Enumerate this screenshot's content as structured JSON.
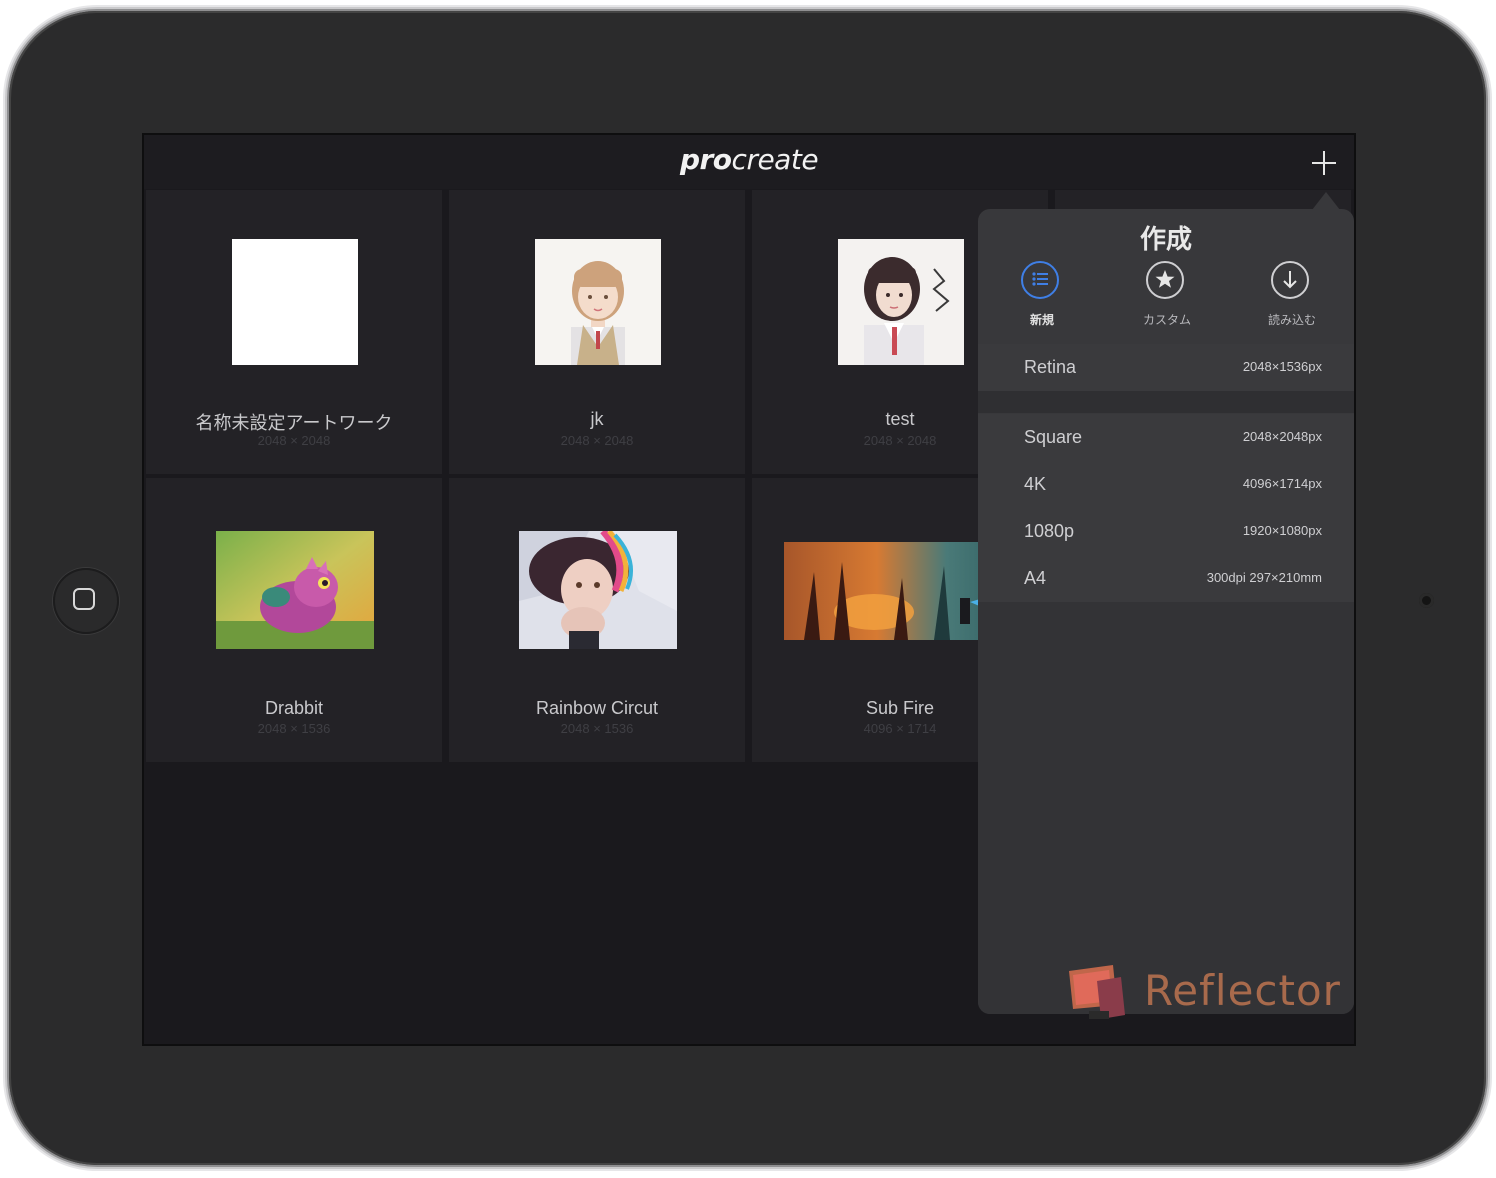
{
  "app": {
    "logo_bold": "pro",
    "logo_rest": "create"
  },
  "gallery": [
    {
      "title": "名称未設定アートワーク",
      "dims": "2048 × 2048"
    },
    {
      "title": "jk",
      "dims": "2048 × 2048"
    },
    {
      "title": "test",
      "dims": "2048 × 2048"
    },
    {
      "title": "Drabbit",
      "dims": "2048 × 1536"
    },
    {
      "title": "Rainbow Circut",
      "dims": "2048 × 1536"
    },
    {
      "title": "Sub Fire",
      "dims": "4096 × 1714"
    }
  ],
  "popover": {
    "title": "作成",
    "tabs": [
      {
        "label": "新規",
        "icon": "list-icon",
        "active": true
      },
      {
        "label": "カスタム",
        "icon": "star-icon",
        "active": false
      },
      {
        "label": "読み込む",
        "icon": "download-icon",
        "active": false
      }
    ],
    "sizes": [
      {
        "name": "Retina",
        "size": "2048×1536px"
      },
      {
        "name": "Square",
        "size": "2048×2048px"
      },
      {
        "name": "4K",
        "size": "4096×1714px"
      },
      {
        "name": "1080p",
        "size": "1920×1080px"
      },
      {
        "name": "A4",
        "size": "300dpi 297×210mm"
      }
    ]
  },
  "watermark": {
    "text": "Reflector"
  },
  "colors": {
    "accent": "#3f7fe6",
    "screen_bg": "#1a191d",
    "tile_bg": "#232226",
    "popover_bg": "#38383b",
    "watermark": "#a86a4c"
  }
}
